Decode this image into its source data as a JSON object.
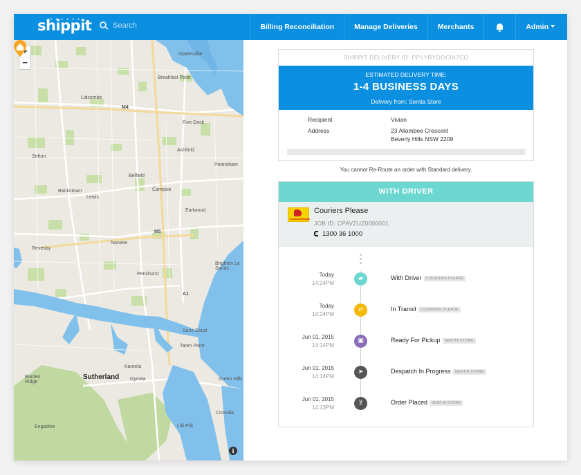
{
  "nav": {
    "logo": "shippit",
    "search_placeholder": "Search",
    "items": [
      "Billing Reconciliation",
      "Manage Deliveries",
      "Merchants"
    ],
    "admin": "Admin"
  },
  "map": {
    "zoom_in": "+",
    "zoom_out": "−",
    "info": "i",
    "labels": {
      "gladesville": "Gladesville",
      "lidcombe": "Lidcombe",
      "five_dock": "Five Dock",
      "ashfield": "Ashfield",
      "sefton": "Sefton",
      "belfield": "Belfield",
      "petersham": "Petersham",
      "campsie": "Campsie",
      "bankstown": "Bankstown",
      "lewis": "Lewis",
      "earlwood": "Earlwood",
      "narwee": "Narwee",
      "revesby": "Revesby",
      "penshurst": "Penshurst",
      "brighton": "Brighton Le Sands",
      "sans_souci": "Sans Souci",
      "taren_point": "Taren Point",
      "kareela": "Kareela",
      "sutherland": "Sutherland",
      "gymea": "Gymea",
      "green_hills": "Green Hills",
      "cronulla": "Cronulla",
      "barden_ridge": "Barden Ridge",
      "engadine": "Engadine",
      "lilli_pilli": "Lilli Pilli",
      "breakfast_point": "Breakfast Point",
      "m4": "M4",
      "m5": "M5",
      "a1": "A1"
    }
  },
  "delivery": {
    "id_line": "SHIPPIT DELIVERY ID: PP1YRYDOCIA7CO",
    "eta_label": "ESTIMATED DELIVERY TIME:",
    "eta_value": "1-4 BUSINESS DAYS",
    "from": "Delivery from: Sentia Store",
    "recipient_label": "Recipient",
    "recipient": "Vivian",
    "address_label": "Address",
    "address_line1": "23 Allambee Crescent",
    "address_line2": "Beverly Hills NSW 2209",
    "reroute_note": "You cannot Re-Route an order with Standard delivery."
  },
  "driver": {
    "status": "WITH DRIVER",
    "courier_name": "Couriers Please",
    "logo_text": "CouriersPlease",
    "job_id": "JOB ID: CPAVZUZ0000001",
    "phone": "1300 36 1000"
  },
  "timeline": [
    {
      "date": "Today",
      "time": "14:24PM",
      "status": "With Driver",
      "badge": "COURIERS PLEASE",
      "icon": "truck-icon",
      "color": "#6bd7d0",
      "glyph": "▰"
    },
    {
      "date": "Today",
      "time": "14:24PM",
      "status": "In Transit",
      "badge": "COURIERS PLEASE",
      "icon": "transit-arrows-icon",
      "color": "#f5b800",
      "glyph": "⇄"
    },
    {
      "date": "Jun 01, 2015",
      "time": "14:14PM",
      "status": "Ready For Pickup",
      "badge": "SENTIA STORE",
      "icon": "package-icon",
      "color": "#8a6fb8",
      "glyph": "▣"
    },
    {
      "date": "Jun 01, 2015",
      "time": "14:14PM",
      "status": "Despatch In Progress",
      "badge": "SENTIA STORE",
      "icon": "paper-plane-icon",
      "color": "#555555",
      "glyph": "➤"
    },
    {
      "date": "Jun 01, 2015",
      "time": "14:13PM",
      "status": "Order Placed",
      "badge": "SENTIA STORE",
      "icon": "cart-icon",
      "color": "#555555",
      "glyph": "⊻"
    }
  ]
}
